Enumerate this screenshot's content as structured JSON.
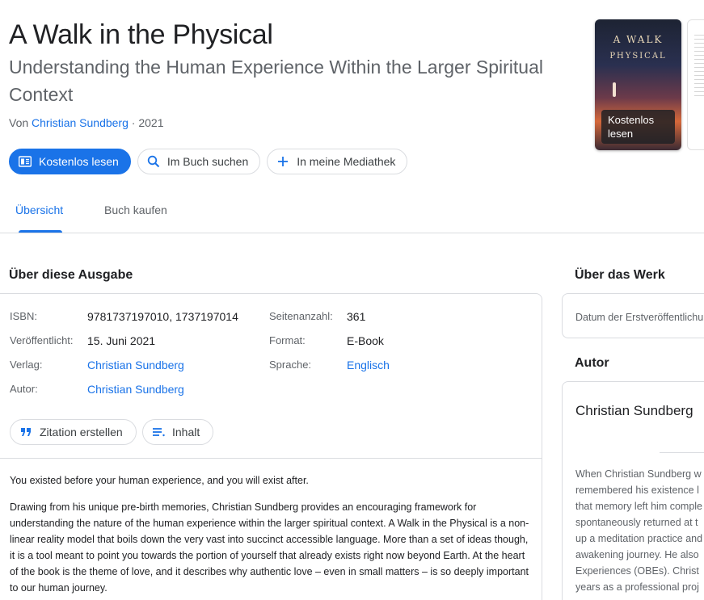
{
  "book": {
    "title": "A Walk in the Physical",
    "subtitle": "Understanding the Human Experience Within the Larger Spiritual Context",
    "by_prefix": "Von",
    "author": "Christian Sundberg",
    "year_sep": "· 2021"
  },
  "actions": {
    "read_free": "Kostenlos lesen",
    "search_in_book": "Im Buch suchen",
    "add_to_library": "In meine Mediathek"
  },
  "cover": {
    "title_line1": "A WALK",
    "title_line2": "PHYSICAL",
    "read_overlay": "Kostenlos lesen"
  },
  "tabs": {
    "overview": "Übersicht",
    "buy": "Buch kaufen"
  },
  "edition": {
    "heading": "Über diese Ausgabe",
    "fields": {
      "isbn_label": "ISBN:",
      "isbn_value": "9781737197010, 1737197014",
      "published_label": "Veröffentlicht:",
      "published_value": "15. Juni 2021",
      "publisher_label": "Verlag:",
      "publisher_value": "Christian Sundberg",
      "author_label": "Autor:",
      "author_value": "Christian Sundberg",
      "pages_label": "Seitenanzahl:",
      "pages_value": "361",
      "format_label": "Format:",
      "format_value": "E-Book",
      "language_label": "Sprache:",
      "language_value": "Englisch"
    },
    "cite_button": "Zitation erstellen",
    "contents_button": "Inhalt"
  },
  "description": {
    "p1": "You existed before your human experience, and you will exist after.",
    "p2": "Drawing from his unique pre-birth memories, Christian Sundberg provides an encouraging framework for understanding the nature of the human experience within the larger spiritual context. A Walk in the Physical is a non-linear reality model that boils down the very vast into succinct accessible language. More than a set of ideas though, it is a tool meant to point you towards the portion of yourself that already exists right now beyond Earth. At the heart of the book is the theme of love, and it describes why authentic love – even in small matters – is so deeply important to our human journey."
  },
  "work": {
    "heading": "Über das Werk",
    "first_pub": "Datum der Erstveröffentlichu"
  },
  "author_panel": {
    "heading": "Autor",
    "name": "Christian Sundberg",
    "bio_lines": [
      "When Christian Sundberg w",
      "remembered his existence l",
      "that memory left him comple",
      "spontaneously returned at t",
      "up a meditation practice and",
      "awakening journey. He also",
      "Experiences (OBEs). Christ",
      "years as a professional proj"
    ]
  },
  "colors": {
    "accent": "#1a73e8",
    "text": "#202124",
    "muted": "#5f6368",
    "border": "#dadce0"
  }
}
